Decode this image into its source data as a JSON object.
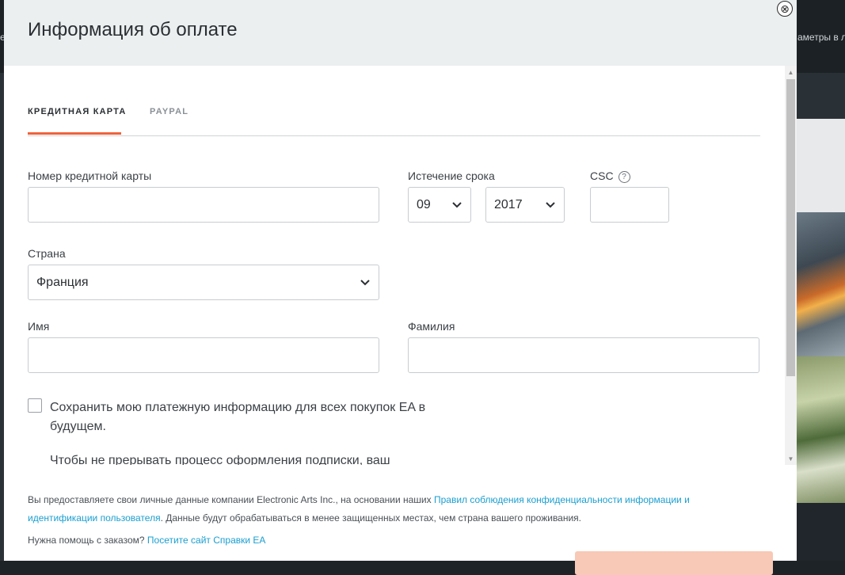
{
  "background": {
    "left_text": "e",
    "right_text": "аметры в л"
  },
  "close_icon": "⊗",
  "modal": {
    "title": "Информация об оплате",
    "tabs": [
      {
        "label": "КРЕДИТНАЯ КАРТА",
        "active": true
      },
      {
        "label": "PAYPAL",
        "active": false
      }
    ],
    "card_number": {
      "label": "Номер кредитной карты",
      "value": ""
    },
    "expiry": {
      "label": "Истечение срока",
      "month": "09",
      "year": "2017"
    },
    "csc": {
      "label": "CSC",
      "help_icon": "?",
      "value": ""
    },
    "country": {
      "label": "Страна",
      "value": "Франция"
    },
    "first_name": {
      "label": "Имя",
      "value": ""
    },
    "last_name": {
      "label": "Фамилия",
      "value": ""
    },
    "save_info": {
      "checked": false,
      "label": "Сохранить мою платежную информацию для всех покупок EA в будущем.",
      "note": "Чтобы не прерывать процесс оформления подписки, ваш"
    },
    "footer": {
      "privacy_prefix": "Вы предоставляете свои личные данные компании Electronic Arts Inc., на основании наших ",
      "privacy_link": "Правил соблюдения конфиденциальности информации и идентификации пользователя",
      "privacy_suffix": ". Данные будут обрабатываться в менее защищенных местах, чем страна вашего проживания.",
      "help_prefix": "Нужна помощь с заказом? ",
      "help_link": "Посетите сайт Справки EA"
    },
    "colors": {
      "accent": "#f0623a",
      "link": "#1a9fd0",
      "header_bg": "#ebeff0"
    }
  }
}
